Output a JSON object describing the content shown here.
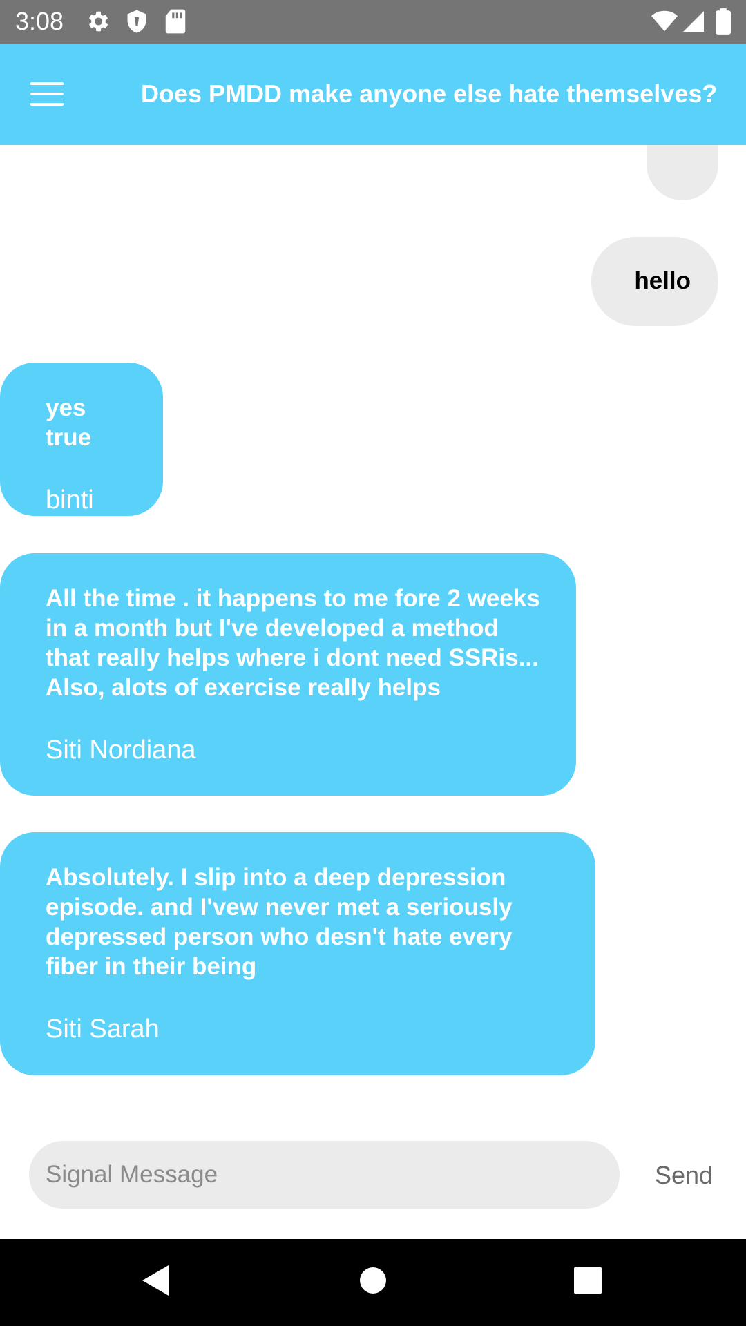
{
  "status_bar": {
    "time": "3:08",
    "icons": [
      "settings-gear-icon",
      "shield-icon",
      "sd-card-icon",
      "wifi-icon",
      "cellular-signal-icon",
      "battery-icon"
    ]
  },
  "app_bar": {
    "menu_icon": "hamburger-menu-icon",
    "title": "Does PMDD make anyone else hate themselves?"
  },
  "messages": [
    {
      "direction": "outgoing",
      "text": ""
    },
    {
      "direction": "outgoing",
      "text": "hello"
    },
    {
      "direction": "incoming",
      "text": "yes true",
      "author": "binti"
    },
    {
      "direction": "incoming",
      "text": "All the time . it happens to me fore 2 weeks in a month but I've developed a method that really helps where i dont need SSRis... Also, alots of exercise really helps",
      "author": "Siti Nordiana"
    },
    {
      "direction": "incoming",
      "text": "Absolutely. I slip into a deep depression episode. and I'vew never met a seriously depressed person who desn't hate every fiber in their being",
      "author": "Siti Sarah"
    }
  ],
  "composer": {
    "placeholder": "Signal Message",
    "value": "",
    "send_label": "Send"
  },
  "nav_bar": {
    "icons": [
      "back-icon",
      "home-icon",
      "recents-icon"
    ]
  },
  "colors": {
    "accent": "#5ad1f8",
    "outgoing_bubble": "#ebebeb",
    "status_bar": "#757575"
  }
}
